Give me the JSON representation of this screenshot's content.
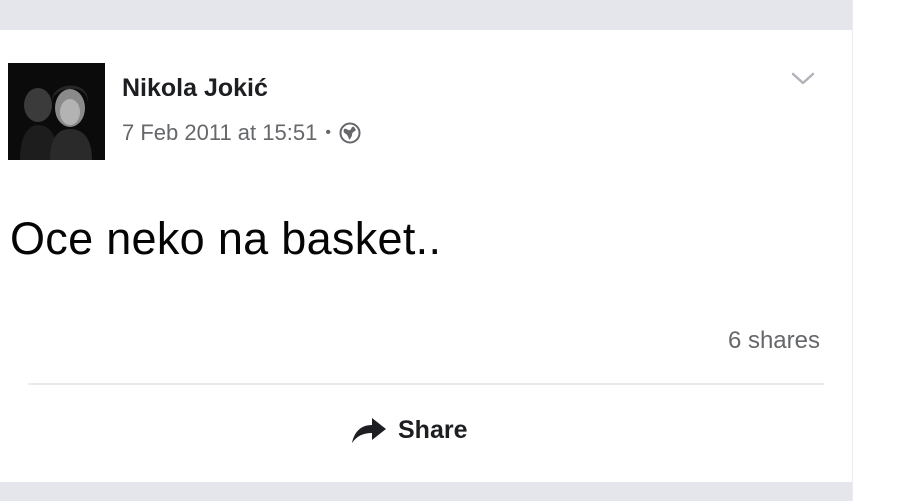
{
  "post": {
    "author": "Nikola Jokić",
    "timestamp": "7 Feb 2011 at 15:51",
    "separator": "•",
    "privacy_icon": "globe-icon",
    "menu_icon": "chevron-down-icon",
    "text": "Oce neko na basket..",
    "shares": "6 shares"
  },
  "actions": {
    "share_label": "Share",
    "share_icon": "share-arrow-icon"
  },
  "colors": {
    "background_strip": "#e4e6eb",
    "primary_text": "#1c1e21",
    "secondary_text": "#65676b"
  }
}
